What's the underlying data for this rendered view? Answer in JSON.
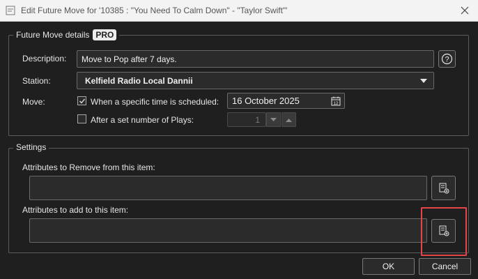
{
  "window": {
    "title": "Edit Future Move for '10385 : \"You Need To Calm Down\" - \"Taylor Swift\"'",
    "icons": {
      "app": "document-icon",
      "close": "close-icon"
    }
  },
  "future_move": {
    "legend": "Future Move details",
    "badge": "PRO",
    "description_label": "Description:",
    "description_value": "Move to Pop after 7 days.",
    "help_icon": "help-icon",
    "station_label": "Station:",
    "station_value": "Kelfield Radio Local Dannii",
    "move_label": "Move:",
    "scheduled_label": "When a specific time is scheduled:",
    "scheduled_checked": true,
    "date_value": "16 October 2025",
    "plays_label": "After a set number of Plays:",
    "plays_checked": false,
    "plays_value": "1"
  },
  "settings": {
    "legend": "Settings",
    "remove_label": "Attributes to Remove from this item:",
    "remove_value": "",
    "add_label": "Attributes to add to this item:",
    "add_value": "",
    "picker_icon": "attribute-picker-icon"
  },
  "buttons": {
    "ok": "OK",
    "cancel": "Cancel"
  },
  "colors": {
    "background": "#1f1f1f",
    "highlight": "#e64545"
  }
}
